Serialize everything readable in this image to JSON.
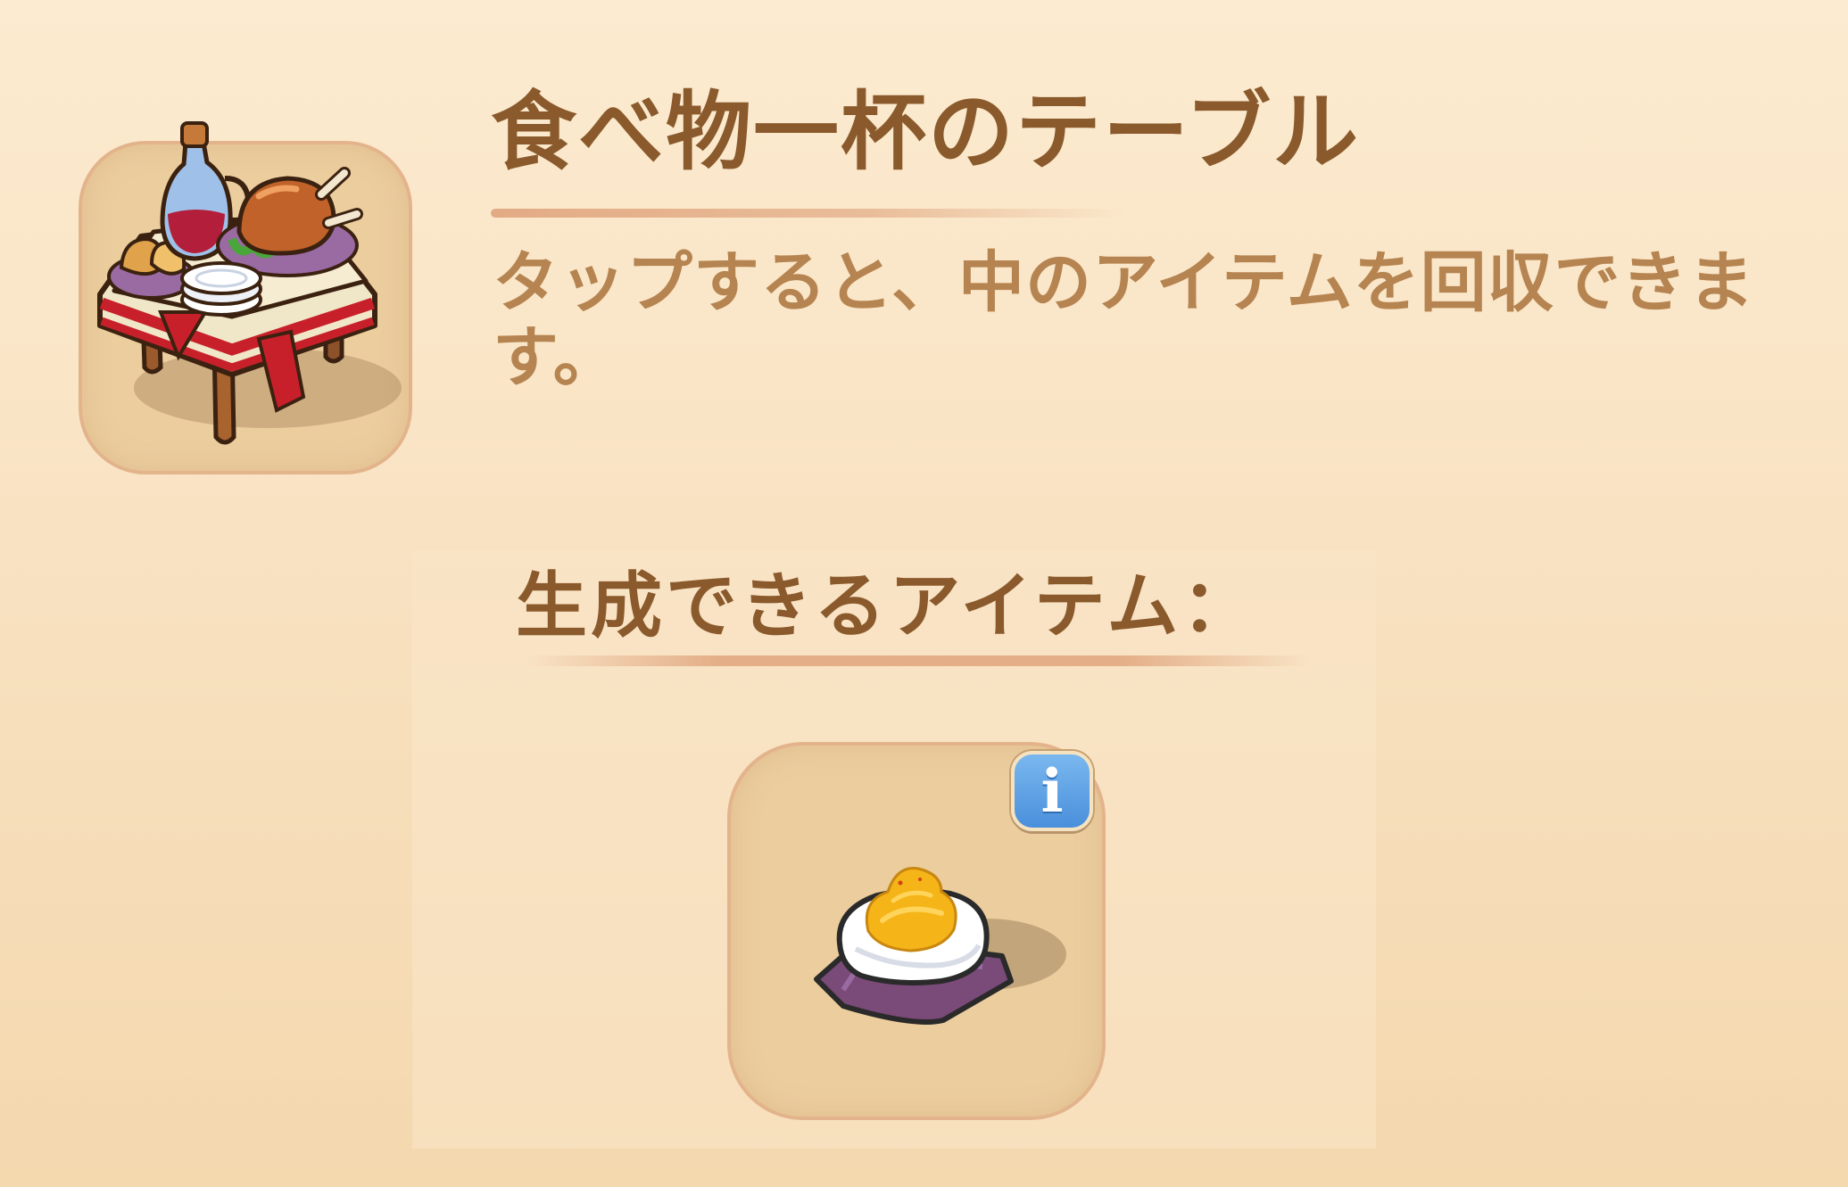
{
  "details": {
    "title": "食べ物一杯のテーブル",
    "description": "タップすると、中のアイテムを回収できます。",
    "icon": "food-table-icon"
  },
  "generation": {
    "label": "生成できるアイテム：",
    "items": [
      {
        "icon": "deviled-egg-icon",
        "info_label": "i",
        "info_icon": "info-icon"
      }
    ]
  }
}
